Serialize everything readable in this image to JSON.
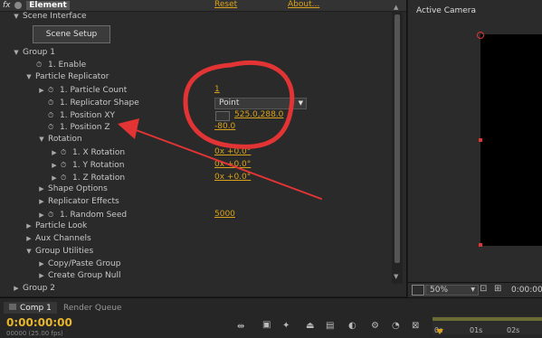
{
  "effect_controls": {
    "fx_label": "fx",
    "effect_name": "Element",
    "reset_label": "Reset",
    "about_label": "About...",
    "scene_interface": "Scene Interface",
    "scene_setup_button": "Scene Setup",
    "group1": "Group 1",
    "enable": "1. Enable",
    "particle_replicator": "Particle Replicator",
    "particle_count": {
      "label": "1. Particle Count",
      "value": "1"
    },
    "replicator_shape": {
      "label": "1. Replicator Shape",
      "value": "Point"
    },
    "position_xy": {
      "label": "1. Position XY",
      "value": "525.0,288.0"
    },
    "position_z": {
      "label": "1. Position Z",
      "value": "-80.0"
    },
    "rotation": "Rotation",
    "x_rotation": {
      "label": "1. X Rotation",
      "value": "0x +0.0°"
    },
    "y_rotation": {
      "label": "1. Y Rotation",
      "value": "0x +0.0°"
    },
    "z_rotation": {
      "label": "1. Z Rotation",
      "value": "0x +0.0°"
    },
    "shape_options": "Shape Options",
    "replicator_effects": "Replicator Effects",
    "random_seed": {
      "label": "1. Random Seed",
      "value": "5000"
    },
    "particle_look": "Particle Look",
    "aux_channels": "Aux Channels",
    "group_utilities": "Group Utilities",
    "copy_paste_group": "Copy/Paste Group",
    "create_group_null": "Create Group Null",
    "group2": "Group 2"
  },
  "viewer": {
    "title": "Active Camera",
    "zoom": "50%",
    "timecode": "0:00:00:"
  },
  "timeline": {
    "comp_tab": "Comp 1",
    "render_queue_tab": "Render Queue",
    "timecode": "0:00:00:00",
    "frame_info": "00000 (25.00 fps)",
    "ruler": [
      "0s",
      "01s",
      "02s"
    ]
  },
  "colors": {
    "accent": "#d9a219",
    "annotation": "#e23434"
  }
}
